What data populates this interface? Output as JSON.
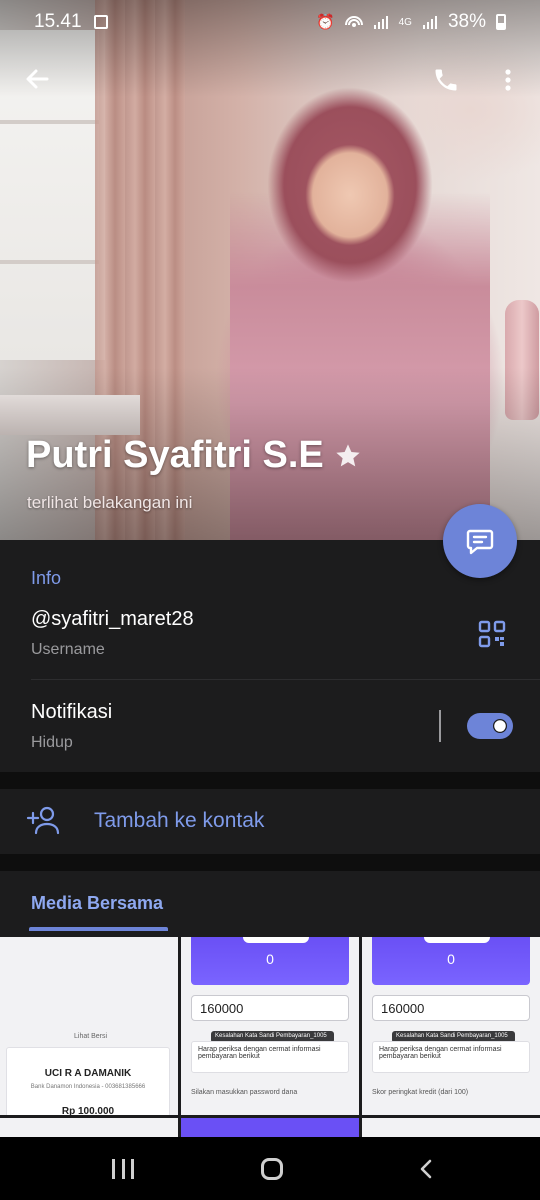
{
  "status_bar": {
    "time": "15.41",
    "network": "4G",
    "battery": "38%"
  },
  "profile": {
    "name": "Putri Syafitri S.E",
    "status": "terlihat belakangan ini"
  },
  "info": {
    "section_title": "Info",
    "username_value": "@syafitri_maret28",
    "username_label": "Username",
    "notification_title": "Notifikasi",
    "notification_value": "Hidup",
    "notification_on": true
  },
  "add_contact": {
    "label": "Tambah ke kontak"
  },
  "media": {
    "tab_label": "Media Bersama",
    "thumbnails": [
      {
        "header": "Lihat Bersi",
        "name": "UCI R A DAMANIK",
        "bank": "Bank Danamon Indonesia - 003681385666",
        "amount": "Rp 100.000"
      },
      {
        "zero": "0",
        "input": "160000",
        "toast": "Kesalahan Kata Sandi Pembayaran_1005",
        "card_text": "Harap periksa dengan cermat informasi pembayaran berikut",
        "hint": "Silakan masukkan password dana"
      },
      {
        "zero": "0",
        "input": "160000",
        "toast": "Kesalahan Kata Sandi Pembayaran_1005",
        "card_text": "Harap periksa dengan cermat informasi pembayaran berikut",
        "hint": "Skor peringkat kredit (dari 100)"
      }
    ]
  },
  "colors": {
    "accent": "#6d84d8",
    "accent_text": "#7f9bea",
    "surface": "#1c1c1d",
    "background": "#0e0e0e"
  }
}
